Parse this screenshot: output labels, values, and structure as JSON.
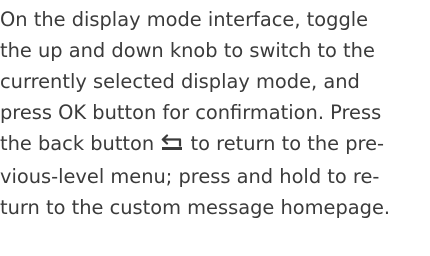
{
  "text": {
    "line1": "On the display mode interface, toggle",
    "line2": "the up and down knob to switch to the",
    "line3": "currently selected display mode, and",
    "line4": "press OK button for confirmation. Press",
    "line5_before_icon": "the back button ",
    "line5_after_icon": " to return to the pre-",
    "line6": "vious-level menu; press and hold to re-",
    "line7": "turn to the custom message homepage."
  },
  "icons": {
    "back_button": "back-arrow-icon"
  },
  "colors": {
    "text": "#3b3b3b",
    "background": "#ffffff"
  }
}
